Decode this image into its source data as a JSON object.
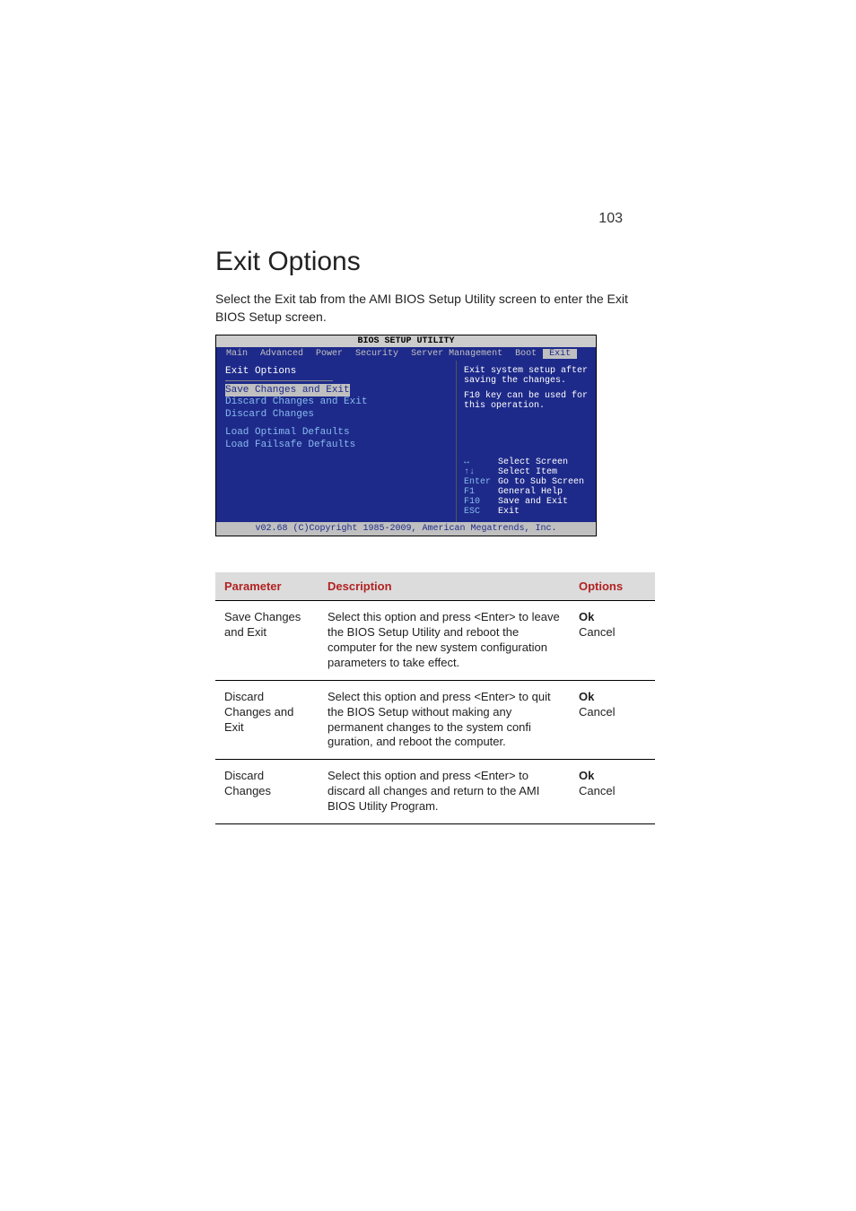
{
  "page_number": "103",
  "title": "Exit Options",
  "intro": "Select the Exit tab from the AMI BIOS Setup Utility screen to enter the Exit BIOS Setup screen.",
  "bios": {
    "window_title": "BIOS SETUP UTILITY",
    "tabs": {
      "t0": "Main",
      "t1": "Advanced",
      "t2": "Power",
      "t3": "Security",
      "t4": "Server Management",
      "t5": "Boot",
      "t6": "Exit"
    },
    "left_header": "Exit Options",
    "items": {
      "i0": "Save Changes and Exit",
      "i1": "Discard Changes and Exit",
      "i2": "Discard Changes",
      "i3": "Load Optimal Defaults",
      "i4": "Load Failsafe Defaults"
    },
    "help_line1": "Exit system setup after saving the changes.",
    "help_line2": "F10 key can be used for this operation.",
    "keys": {
      "k0k": "↔",
      "k0l": "Select Screen",
      "k1k": "↑↓",
      "k1l": "Select Item",
      "k2k": "Enter",
      "k2l": "Go to Sub Screen",
      "k3k": "F1",
      "k3l": "General Help",
      "k4k": "F10",
      "k4l": "Save and Exit",
      "k5k": "ESC",
      "k5l": "Exit"
    },
    "footer": "v02.68 (C)Copyright 1985-2009, American Megatrends, Inc."
  },
  "table": {
    "headers": {
      "h0": "Parameter",
      "h1": "Description",
      "h2": "Options"
    },
    "rows": {
      "r0": {
        "param": "Save Changes and Exit",
        "desc": "Select this option and press <Enter> to leave the BIOS Setup Utility and reboot the computer for the new system configuration parameters to take effect.",
        "opt1": "Ok",
        "opt2": "Cancel"
      },
      "r1": {
        "param": "Discard Changes and Exit",
        "desc": "Select this option and press <Enter> to quit the BIOS Setup without making any permanent changes to the system confi guration, and reboot the computer.",
        "opt1": "Ok",
        "opt2": "Cancel"
      },
      "r2": {
        "param": "Discard Changes",
        "desc": "Select this option and press <Enter> to discard all changes and return to the AMI BIOS Utility Program.",
        "opt1": "Ok",
        "opt2": "Cancel"
      }
    }
  }
}
